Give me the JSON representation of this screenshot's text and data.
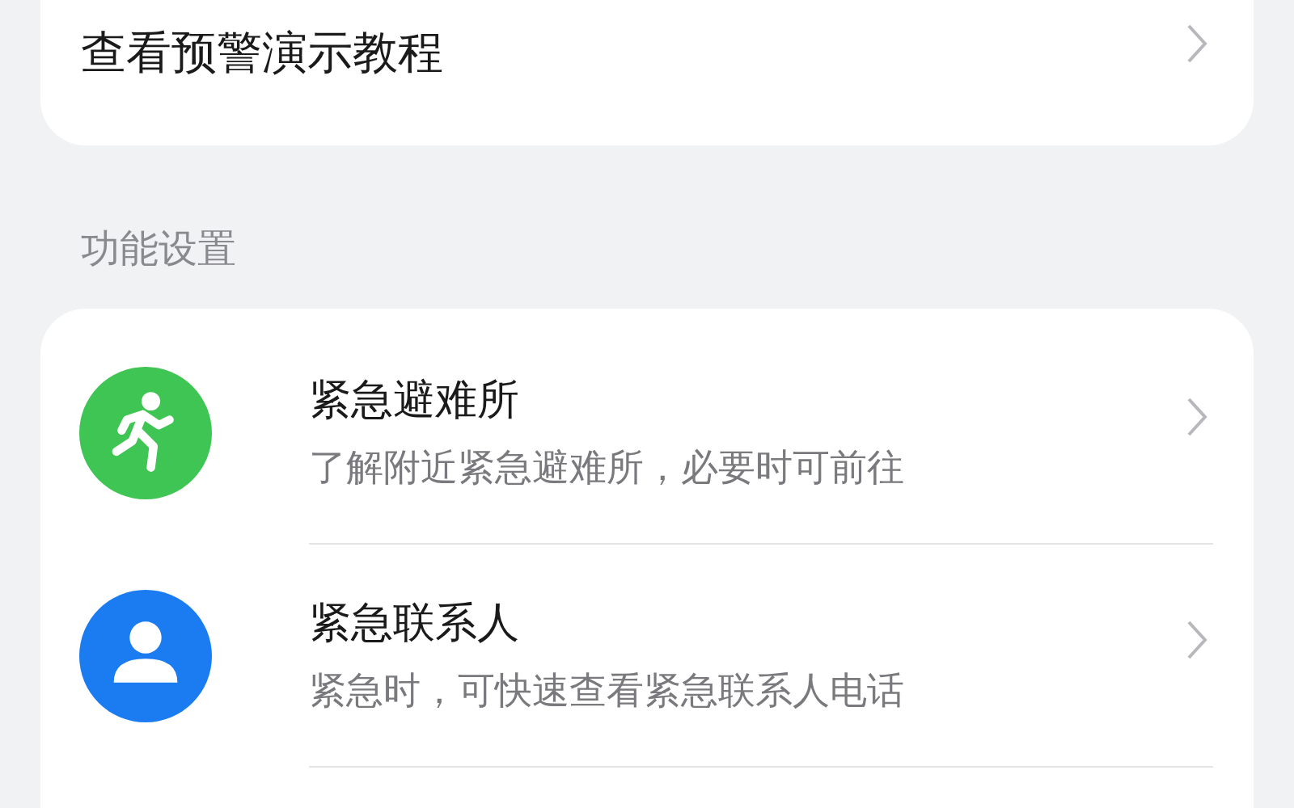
{
  "top_item": {
    "label": "查看预警演示教程"
  },
  "section_title": "功能设置",
  "items": [
    {
      "kind": "shelter",
      "title": "紧急避难所",
      "subtitle": "了解附近紧急避难所，必要时可前往",
      "color": "#3fc553"
    },
    {
      "kind": "contact",
      "title": "紧急联系人",
      "subtitle": "紧急时，可快速查看紧急联系人电话",
      "color": "#1a7cf0"
    }
  ]
}
